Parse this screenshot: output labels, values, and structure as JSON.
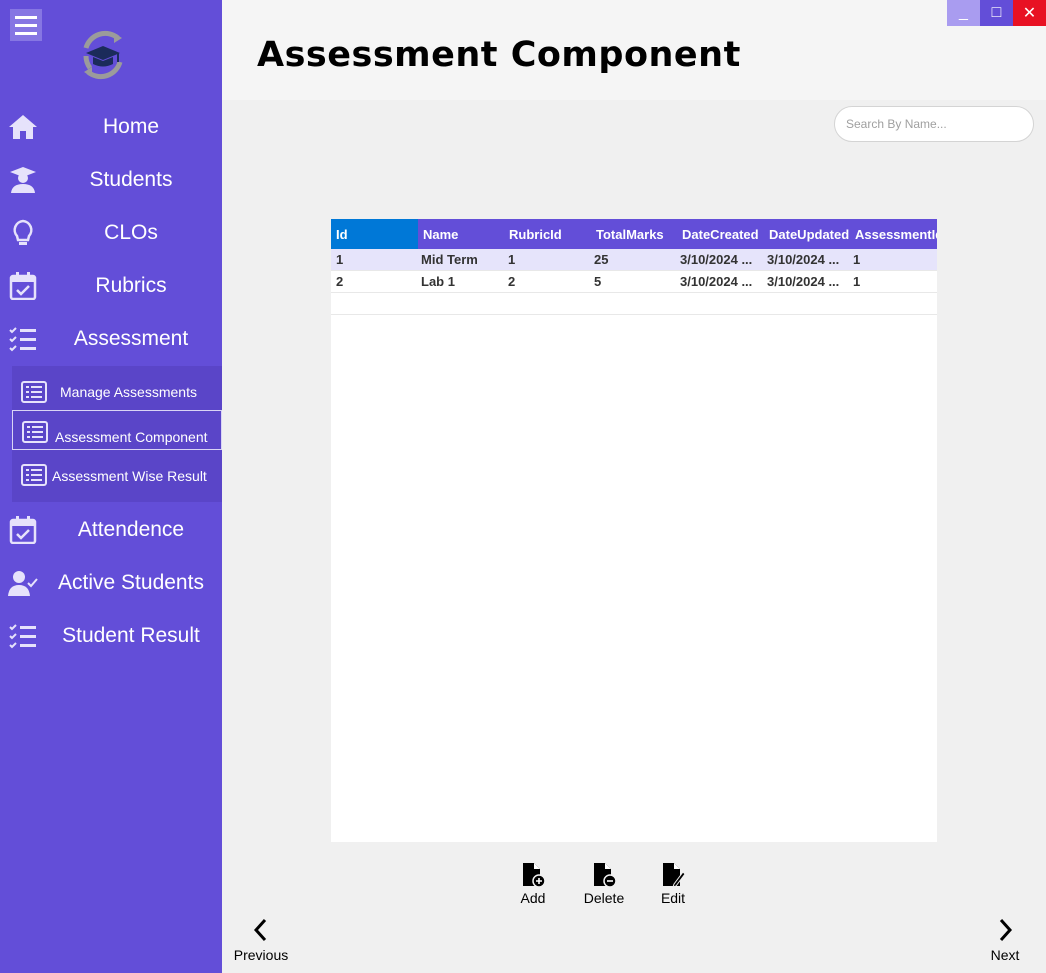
{
  "window": {
    "minimize_label": "_",
    "maximize_label": "□",
    "close_label": "✕"
  },
  "header": {
    "title": "Assessment Component"
  },
  "search": {
    "placeholder": "Search By Name..."
  },
  "sidebar": {
    "items": [
      {
        "label": "Home",
        "icon": "home-icon"
      },
      {
        "label": "Students",
        "icon": "graduate-icon"
      },
      {
        "label": "CLOs",
        "icon": "lightbulb-icon"
      },
      {
        "label": "Rubrics",
        "icon": "calendar-check-icon"
      },
      {
        "label": "Assessment",
        "icon": "checklist-icon"
      },
      {
        "label": "Attendence",
        "icon": "calendar-check-icon"
      },
      {
        "label": "Active Students",
        "icon": "user-check-icon"
      },
      {
        "label": "Student Result",
        "icon": "checklist-icon"
      }
    ],
    "submenu": [
      {
        "label": "Manage Assessments",
        "icon": "list-icon"
      },
      {
        "label": "Assessment Component",
        "icon": "list-icon"
      },
      {
        "label": "Assessment Wise Result",
        "icon": "list-icon"
      }
    ]
  },
  "grid": {
    "columns": [
      "Id",
      "Name",
      "RubricId",
      "TotalMarks",
      "DateCreated",
      "DateUpdated",
      "AssessmentId"
    ],
    "rows": [
      [
        "1",
        "Mid Term",
        "1",
        "25",
        "3/10/2024 ...",
        "3/10/2024 ...",
        "1"
      ],
      [
        "2",
        "Lab 1",
        "2",
        "5",
        "3/10/2024 ...",
        "3/10/2024 ...",
        "1"
      ]
    ]
  },
  "actions": {
    "add": "Add",
    "delete": "Delete",
    "edit": "Edit"
  },
  "nav": {
    "previous": "Previous",
    "next": "Next"
  },
  "colors": {
    "sidebar": "#634ed8",
    "selected_header": "#0078d7",
    "close": "#e81123"
  }
}
